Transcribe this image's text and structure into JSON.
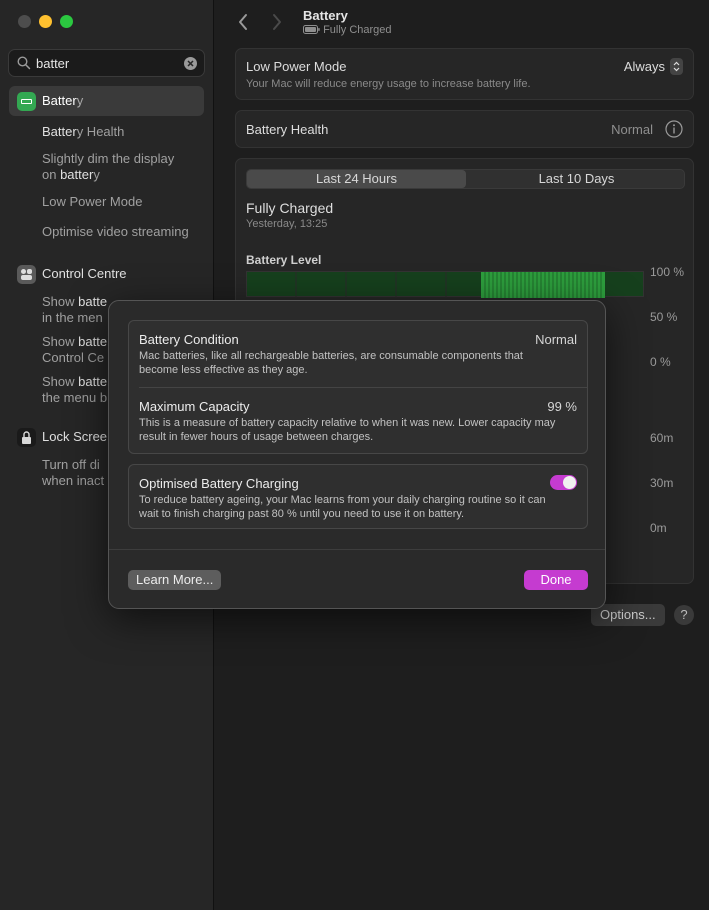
{
  "colors": {
    "accent": "#c53bd0",
    "battery_icon": "#33a852",
    "chart_green": "#2d9e3d",
    "chart_bg_green": "#16401d",
    "control_centre_icon": "#5a5a5a",
    "lock_screen_icon": "#1a1a1a"
  },
  "sidebar": {
    "search": {
      "query": "batter",
      "search_icon": "magnifier-icon",
      "clear_icon": "clear-x-icon"
    },
    "results": [
      {
        "label_prefix": "Batter",
        "label_suffix": "y",
        "icon": "battery-icon",
        "children": [
          {
            "prefix": "Batter",
            "suffix": "y Health"
          },
          {
            "line1": "Slightly dim the display",
            "line2_prefix": "on ",
            "line2_match": "batter",
            "line2_suffix": "y"
          },
          {
            "text": "Low Power Mode"
          },
          {
            "text": "Optimise video streaming"
          }
        ]
      },
      {
        "label": "Control Centre",
        "icon": "control-centre-icon",
        "children": [
          {
            "line1_prefix": "Show ",
            "line1_match": "batte",
            "line2": "in the men"
          },
          {
            "line1_prefix": "Show ",
            "line1_match": "batte",
            "line2": "Control Ce"
          },
          {
            "line1_prefix": "Show ",
            "line1_match": "batte",
            "line2": "the menu b"
          }
        ]
      },
      {
        "label": "Lock Scree",
        "icon": "lock-screen-icon",
        "children": [
          {
            "line1": "Turn off di",
            "line2": "when inact"
          }
        ]
      }
    ]
  },
  "header": {
    "title": "Battery",
    "subtitle": "Fully Charged",
    "back_icon": "chevron-left-icon",
    "forward_icon": "chevron-right-icon",
    "status_icon": "battery-charged-icon"
  },
  "low_power": {
    "title": "Low Power Mode",
    "description": "Your Mac will reduce energy usage to increase battery life.",
    "value": "Always"
  },
  "battery_health": {
    "title": "Battery Health",
    "value": "Normal",
    "info_icon": "info-icon"
  },
  "usage": {
    "tabs": [
      "Last 24 Hours",
      "Last 10 Days"
    ],
    "status_title": "Fully Charged",
    "status_time": "Yesterday, 13:25",
    "chart_title": "Battery Level",
    "level_axis": [
      "100 %",
      "50 %",
      "0 %"
    ],
    "usage_axis": [
      "60m",
      "30m",
      "0m"
    ]
  },
  "footer": {
    "options_label": "Options...",
    "help_label": "?"
  },
  "sheet": {
    "condition": {
      "title": "Battery Condition",
      "value": "Normal",
      "description": "Mac batteries, like all rechargeable batteries, are consumable components that become less effective as they age."
    },
    "capacity": {
      "title": "Maximum Capacity",
      "value": "99 %",
      "description": "This is a measure of battery capacity relative to when it was new. Lower capacity may result in fewer hours of usage between charges."
    },
    "optimised": {
      "title": "Optimised Battery Charging",
      "description": "To reduce battery ageing, your Mac learns from your daily charging routine so it can wait to finish charging past 80 % until you need to use it on battery.",
      "enabled": true
    },
    "learn_more_label": "Learn More...",
    "done_label": "Done"
  }
}
